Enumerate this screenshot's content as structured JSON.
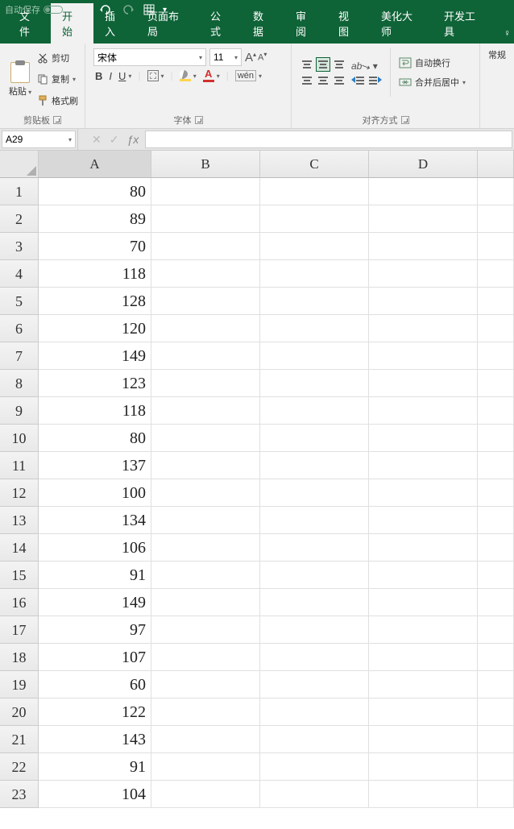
{
  "titlebar": {
    "autosave": "自动保存"
  },
  "tabs": {
    "file": "文件",
    "home": "开始",
    "insert": "插入",
    "layout": "页面布局",
    "formulas": "公式",
    "data": "数据",
    "review": "审阅",
    "view": "视图",
    "beautify": "美化大师",
    "dev": "开发工具"
  },
  "ribbon": {
    "clipboard": {
      "paste": "粘贴",
      "cut": "剪切",
      "copy": "复制",
      "format_painter": "格式刷",
      "label": "剪贴板"
    },
    "font": {
      "name": "宋体",
      "size": "11",
      "bold": "B",
      "italic": "I",
      "underline": "U",
      "fontcolor_letter": "A",
      "wen": "wén",
      "label": "字体"
    },
    "align": {
      "wrap": "自动换行",
      "merge": "合并后居中",
      "label": "对齐方式"
    },
    "number_partial": "常规"
  },
  "formula_bar": {
    "namebox": "A29",
    "value": ""
  },
  "columns": [
    "A",
    "B",
    "C",
    "D"
  ],
  "rows": [
    1,
    2,
    3,
    4,
    5,
    6,
    7,
    8,
    9,
    10,
    11,
    12,
    13,
    14,
    15,
    16,
    17,
    18,
    19,
    20,
    21,
    22,
    23
  ],
  "data_A": [
    "80",
    "89",
    "70",
    "118",
    "128",
    "120",
    "149",
    "123",
    "118",
    "80",
    "137",
    "100",
    "134",
    "106",
    "91",
    "149",
    "97",
    "107",
    "60",
    "122",
    "143",
    "91",
    "104"
  ]
}
